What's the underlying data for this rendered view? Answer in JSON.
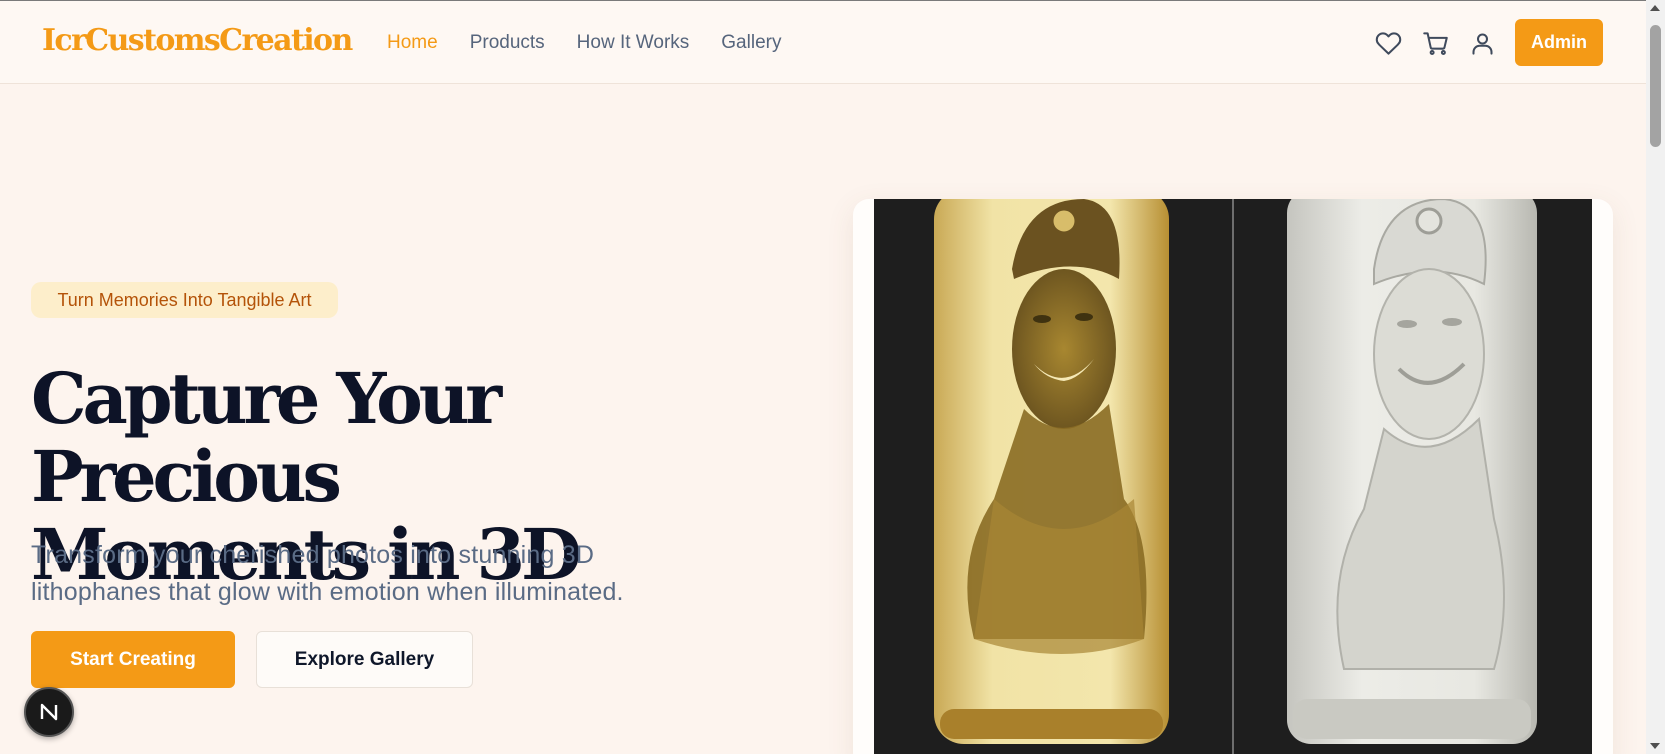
{
  "brand": {
    "name": "IcrCustomsCreation"
  },
  "nav": {
    "items": [
      {
        "label": "Home",
        "active": true
      },
      {
        "label": "Products",
        "active": false
      },
      {
        "label": "How It Works",
        "active": false
      },
      {
        "label": "Gallery",
        "active": false
      }
    ]
  },
  "header_actions": {
    "icons": [
      "heart-icon",
      "cart-icon",
      "user-icon"
    ],
    "admin_label": "Admin"
  },
  "hero": {
    "badge": "Turn Memories Into Tangible Art",
    "title_line1": "Capture Your Precious",
    "title_line2": "Moments in 3D",
    "subtitle_line1": "Transform your cherished photos into stunning 3D",
    "subtitle_line2": "lithophanes that glow with emotion when illuminated.",
    "primary_cta": "Start Creating",
    "secondary_cta": "Explore Gallery"
  },
  "dev_badge": {
    "letter": "N"
  },
  "colors": {
    "accent": "#f49a16",
    "nav_text": "#56657c",
    "title": "#0d1327",
    "background": "#fdf4ee",
    "badge_bg": "#fdeecb",
    "badge_text": "#b45309"
  }
}
